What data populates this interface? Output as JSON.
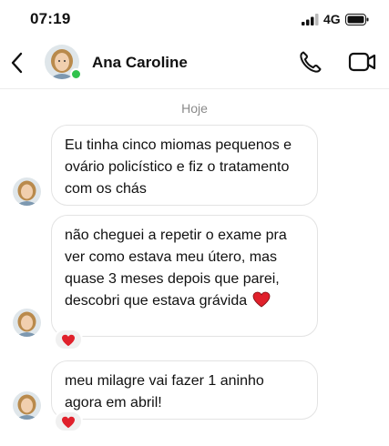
{
  "status_bar": {
    "time": "07:19",
    "network": "4G"
  },
  "header": {
    "contact_name": "Ana Caroline",
    "online": true
  },
  "chat": {
    "date_separator": "Hoje",
    "messages": [
      {
        "text": "Eu tinha cinco miomas pequenos e ovário policístico e fiz o tratamento com os chás",
        "reaction": null
      },
      {
        "text": "não cheguei a repetir o exame pra ver como estava meu útero, mas quase 3 meses depois que parei, descobri que estava grávida",
        "inline_emoji": "red-heart",
        "reaction": "red-heart"
      },
      {
        "text": "meu milagre vai fazer 1 aninho agora em abril!",
        "reaction": "red-heart"
      }
    ]
  },
  "colors": {
    "online": "#31c24d",
    "heart": "#e0202b",
    "bubble_border": "#e3e3e3",
    "reaction_bg": "#f0f0f0"
  },
  "icons": [
    "signal-icon",
    "battery-icon",
    "back-icon",
    "phone-icon",
    "video-icon",
    "heart-icon"
  ]
}
